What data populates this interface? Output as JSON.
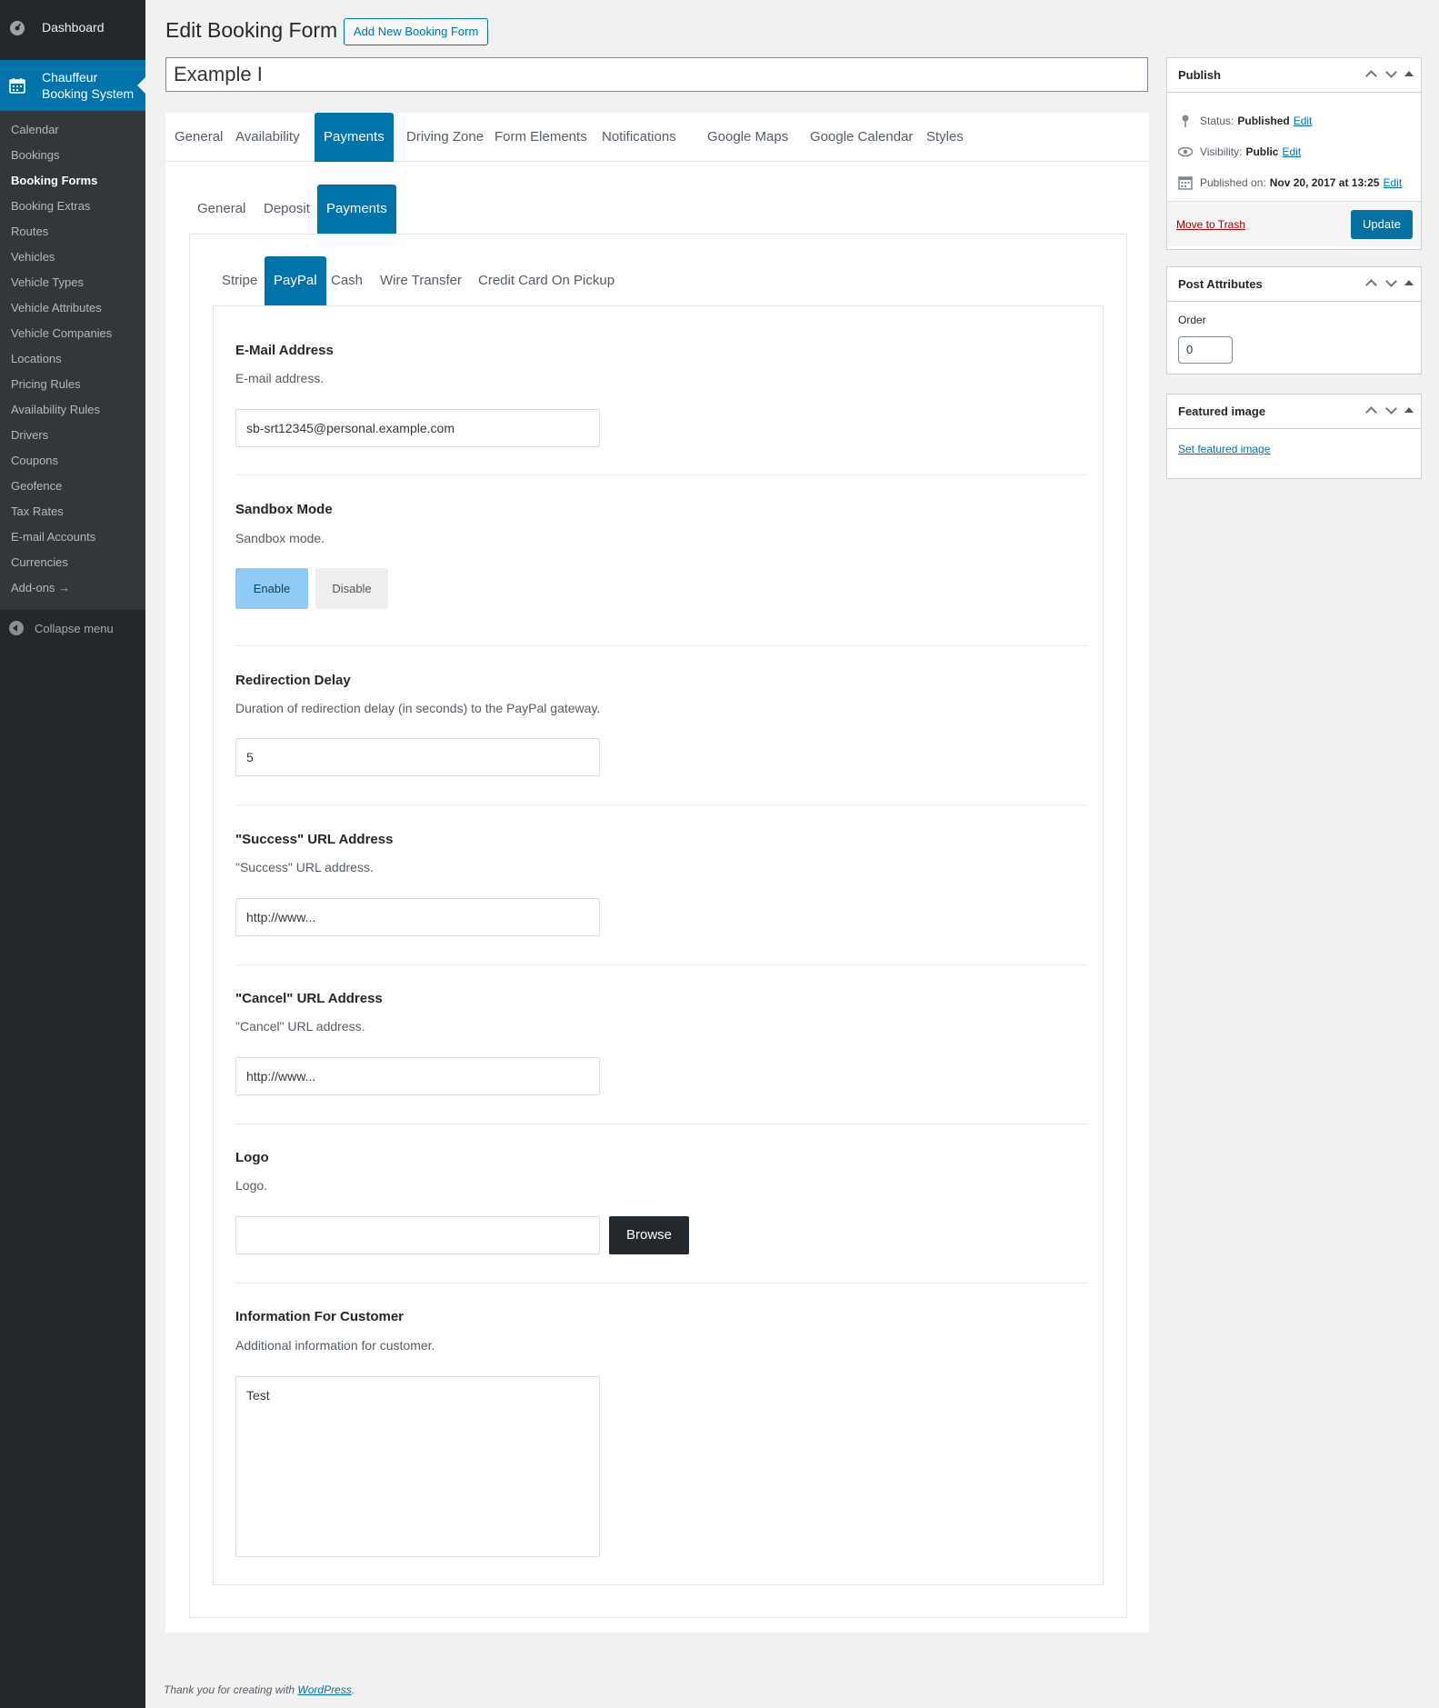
{
  "sidebar": {
    "dashboard": "Dashboard",
    "plugin": "Chauffeur Booking System",
    "items": [
      "Calendar",
      "Bookings",
      "Booking Forms",
      "Booking Extras",
      "Routes",
      "Vehicles",
      "Vehicle Types",
      "Vehicle Attributes",
      "Vehicle Companies",
      "Locations",
      "Pricing Rules",
      "Availability Rules",
      "Drivers",
      "Coupons",
      "Geofence",
      "Tax Rates",
      "E-mail Accounts",
      "Currencies",
      "Add-ons →"
    ],
    "current_item": "Booking Forms",
    "collapse": "Collapse menu"
  },
  "header": {
    "title": "Edit Booking Form",
    "add_new": "Add New Booking Form",
    "post_title": "Example I"
  },
  "tabs": {
    "main": [
      "General",
      "Availability",
      "Payments",
      "Driving Zone",
      "Form Elements",
      "Notifications",
      "Google Maps",
      "Google Calendar",
      "Styles"
    ],
    "main_active": "Payments",
    "sub": [
      "General",
      "Deposit",
      "Payments"
    ],
    "sub_active": "Payments",
    "gateways": [
      "Stripe",
      "PayPal",
      "Cash",
      "Wire Transfer",
      "Credit Card On Pickup"
    ],
    "gateways_active": "PayPal"
  },
  "fields": {
    "email": {
      "title": "E-Mail Address",
      "desc": "E-mail address.",
      "value": "sb-srt12345@personal.example.com"
    },
    "sandbox": {
      "title": "Sandbox Mode",
      "desc": "Sandbox mode.",
      "enable": "Enable",
      "disable": "Disable",
      "selected": "Enable"
    },
    "delay": {
      "title": "Redirection Delay",
      "desc": "Duration of redirection delay (in seconds) to the PayPal gateway.",
      "value": "5"
    },
    "success": {
      "title": "\"Success\" URL Address",
      "desc": "\"Success\" URL address.",
      "value": "http://www..."
    },
    "cancel": {
      "title": "\"Cancel\" URL Address",
      "desc": "\"Cancel\" URL address.",
      "value": "http://www..."
    },
    "logo": {
      "title": "Logo",
      "desc": "Logo.",
      "value": "",
      "browse": "Browse"
    },
    "info": {
      "title": "Information For Customer",
      "desc": "Additional information for customer.",
      "value": "Test"
    }
  },
  "publish": {
    "title": "Publish",
    "status_label": "Status:",
    "status": "Published",
    "visibility_label": "Visibility:",
    "visibility": "Public",
    "published_label": "Published on:",
    "published": "Nov 20, 2017 at 13:25",
    "edit": "Edit",
    "trash": "Move to Trash",
    "update": "Update"
  },
  "attributes": {
    "title": "Post Attributes",
    "order_label": "Order",
    "order": "0"
  },
  "featured": {
    "title": "Featured image",
    "link": "Set featured image"
  },
  "footer": {
    "text": "Thank you for creating with",
    "link": "WordPress",
    "end": "."
  },
  "colors": {
    "accent": "#0073aa",
    "sidebar": "#23282d",
    "enable_bg": "#8fcbf7"
  }
}
